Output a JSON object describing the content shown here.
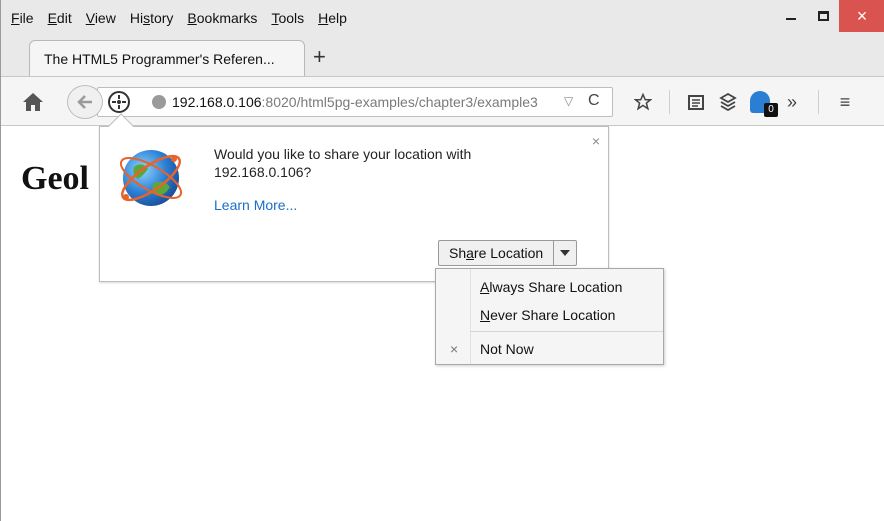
{
  "menubar": {
    "items": [
      {
        "u": "F",
        "rest": "ile"
      },
      {
        "u": "E",
        "rest": "dit"
      },
      {
        "u": "V",
        "rest": "iew"
      },
      {
        "pre": "Hi",
        "u": "s",
        "rest": "tory"
      },
      {
        "u": "B",
        "rest": "ookmarks"
      },
      {
        "u": "T",
        "rest": "ools"
      },
      {
        "u": "H",
        "rest": "elp"
      }
    ]
  },
  "window_controls": {
    "close_glyph": "×"
  },
  "tabs": [
    {
      "label": "The HTML5 Programmer's Referen..."
    }
  ],
  "new_tab_glyph": "+",
  "urlbar": {
    "host": "192.168.0.106",
    "rest": ":8020/html5pg-examples/chapter3/example3",
    "dropdown_glyph": "▽",
    "reload_glyph": "C"
  },
  "toolbar": {
    "ghost_badge": "0",
    "overflow_glyph": "»",
    "menu_glyph": "≡"
  },
  "page": {
    "heading": "Geol"
  },
  "doorhanger": {
    "message": "Would you like to share your location with 192.168.0.106?",
    "learn_more": "Learn More...",
    "close_glyph": "×",
    "share_button": {
      "pre": "Sh",
      "u": "a",
      "rest": "re Location"
    }
  },
  "dropdown": {
    "always": {
      "u": "A",
      "rest": "lways Share Location"
    },
    "never": {
      "u": "N",
      "rest": "ever Share Location"
    },
    "not_now": "Not Now",
    "x_glyph": "×"
  },
  "colors": {
    "close_red": "#d9534f",
    "link_blue": "#1a6fc6",
    "ghost_blue": "#2a7fd4"
  }
}
